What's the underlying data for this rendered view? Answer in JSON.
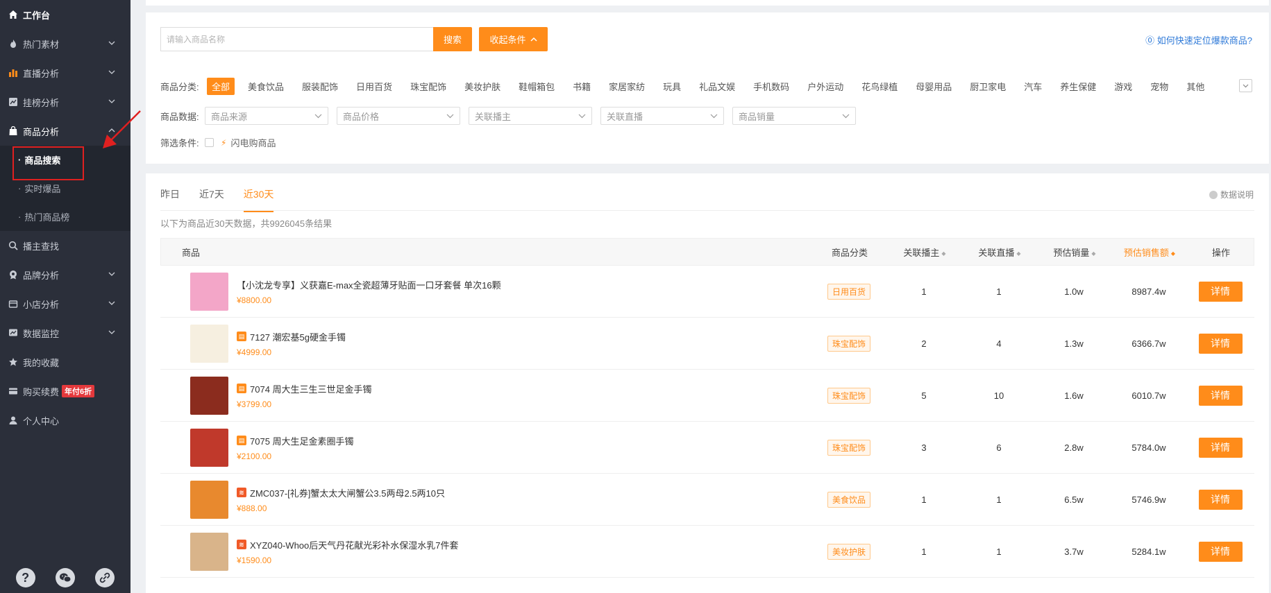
{
  "sidebar": {
    "items": [
      {
        "label": "工作台",
        "icon": "home-icon"
      },
      {
        "label": "热门素材",
        "icon": "fire-icon"
      },
      {
        "label": "直播分析",
        "icon": "bar-chart-icon"
      },
      {
        "label": "挂榜分析",
        "icon": "line-chart-icon"
      },
      {
        "label": "商品分析",
        "icon": "bag-icon"
      },
      {
        "label": "播主查找",
        "icon": "search-icon"
      },
      {
        "label": "品牌分析",
        "icon": "brand-icon"
      },
      {
        "label": "小店分析",
        "icon": "shop-icon"
      },
      {
        "label": "数据监控",
        "icon": "monitor-icon"
      },
      {
        "label": "我的收藏",
        "icon": "star-icon"
      },
      {
        "label": "购买续费",
        "icon": "card-icon",
        "badge": "年付6折"
      },
      {
        "label": "个人中心",
        "icon": "user-icon"
      }
    ],
    "sub_items": [
      {
        "label": "商品搜索"
      },
      {
        "label": "实时爆品"
      },
      {
        "label": "热门商品榜"
      }
    ],
    "bottom_icons": [
      "help-icon",
      "wechat-icon",
      "link-icon"
    ]
  },
  "search": {
    "placeholder": "请输入商品名称",
    "button": "搜索",
    "collapse": "收起条件",
    "help": "如何快速定位爆款商品?"
  },
  "filters": {
    "category_label": "商品分类:",
    "categories": [
      "全部",
      "美食饮品",
      "服装配饰",
      "日用百货",
      "珠宝配饰",
      "美妆护肤",
      "鞋帽箱包",
      "书籍",
      "家居家纺",
      "玩具",
      "礼品文娱",
      "手机数码",
      "户外运动",
      "花鸟绿植",
      "母婴用品",
      "厨卫家电",
      "汽车",
      "养生保健",
      "游戏",
      "宠物",
      "其他"
    ],
    "data_label": "商品数据:",
    "selects": [
      "商品来源",
      "商品价格",
      "关联播主",
      "关联直播",
      "商品销量"
    ],
    "condition_label": "筛选条件:",
    "condition_option": "闪电购商品"
  },
  "tabs": [
    "昨日",
    "近7天",
    "近30天"
  ],
  "data_note": "数据说明",
  "result_text": "以下为商品近30天数据，共9926045条结果",
  "table": {
    "headers": [
      "商品",
      "商品分类",
      "关联播主",
      "关联直播",
      "预估销量",
      "预估销售额",
      "操作"
    ],
    "detail_label": "详情",
    "rows": [
      {
        "name": "【小沈龙专享】义获嘉E-max全瓷超薄牙贴面一口牙套餐 单次16颗",
        "price": "¥8800.00",
        "category": "日用百货",
        "streamers": "1",
        "lives": "1",
        "sales": "1.0w",
        "revenue": "8987.4w",
        "badge": "",
        "badge_color": "",
        "thumb_color": "#f3a6c8"
      },
      {
        "name": "7127 潮宏基5g硬金手镯",
        "price": "¥4999.00",
        "category": "珠宝配饰",
        "streamers": "2",
        "lives": "4",
        "sales": "1.3w",
        "revenue": "6366.7w",
        "badge": "tmall",
        "badge_color": "#ff8c1a",
        "thumb_color": "#f6efe0"
      },
      {
        "name": "7074 周大生三生三世足金手镯",
        "price": "¥3799.00",
        "category": "珠宝配饰",
        "streamers": "5",
        "lives": "10",
        "sales": "1.6w",
        "revenue": "6010.7w",
        "badge": "tmall",
        "badge_color": "#ff8c1a",
        "thumb_color": "#8b2c1e"
      },
      {
        "name": "7075 周大生足金素圈手镯",
        "price": "¥2100.00",
        "category": "珠宝配饰",
        "streamers": "3",
        "lives": "6",
        "sales": "2.8w",
        "revenue": "5784.0w",
        "badge": "tmall",
        "badge_color": "#ff8c1a",
        "thumb_color": "#c0392b"
      },
      {
        "name": "ZMC037-[礼券]蟹太太大闸蟹公3.5两母2.5两10只",
        "price": "¥888.00",
        "category": "美食饮品",
        "streamers": "1",
        "lives": "1",
        "sales": "6.5w",
        "revenue": "5746.9w",
        "badge": "rss",
        "badge_color": "#f05a28",
        "thumb_color": "#e8892e"
      },
      {
        "name": "XYZ040-Whoo后天气丹花献光彩补水保湿水乳7件套",
        "price": "¥1590.00",
        "category": "美妆护肤",
        "streamers": "1",
        "lives": "1",
        "sales": "3.7w",
        "revenue": "5284.1w",
        "badge": "rss",
        "badge_color": "#f05a28",
        "thumb_color": "#d9b48a"
      }
    ]
  }
}
